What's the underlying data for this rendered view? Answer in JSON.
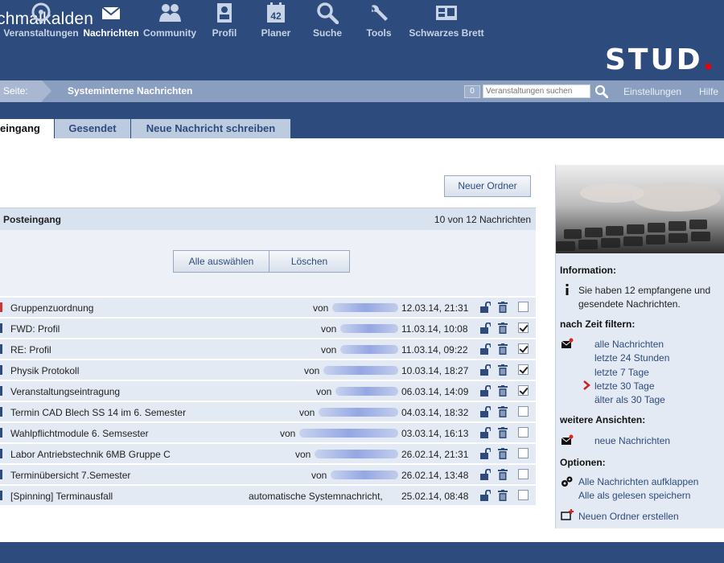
{
  "site_title": "chmalkalden",
  "nav": [
    {
      "label": "Veranstaltungen",
      "icon": "seminar-icon",
      "active": false
    },
    {
      "label": "Nachrichten",
      "icon": "mail-icon",
      "active": true
    },
    {
      "label": "Community",
      "icon": "community-icon",
      "active": false
    },
    {
      "label": "Profil",
      "icon": "profile-icon",
      "active": false
    },
    {
      "label": "Planer",
      "icon": "calendar-icon",
      "active": false,
      "badge": "42"
    },
    {
      "label": "Suche",
      "icon": "search-icon",
      "active": false
    },
    {
      "label": "Tools",
      "icon": "wrench-icon",
      "active": false
    },
    {
      "label": "Schwarzes Brett",
      "icon": "board-icon",
      "active": false
    }
  ],
  "logo": {
    "text": "STUD",
    "dot": "."
  },
  "breadcrumb": {
    "label": "Seite:",
    "page": "Systeminterne Nachrichten"
  },
  "search": {
    "count": "0",
    "placeholder": "Veranstaltungen suchen"
  },
  "top_links": {
    "settings": "Einstellungen",
    "help": "Hilfe"
  },
  "tabs": [
    {
      "label": "eingang",
      "active": true
    },
    {
      "label": "Gesendet",
      "active": false
    },
    {
      "label": "Neue Nachricht schreiben",
      "active": false
    }
  ],
  "buttons": {
    "new_folder": "Neuer Ordner",
    "select_all": "Alle auswählen",
    "delete": "Löschen"
  },
  "inbox": {
    "title": "Posteingang",
    "count": "10 von 12 Nachrichten"
  },
  "messages": [
    {
      "subject": "Gruppenzuordnung",
      "from_label": "von",
      "date": "12.03.14, 21:31",
      "checked": false,
      "marker": "red"
    },
    {
      "subject": "FWD: Profil",
      "from_label": "von",
      "date": "11.03.14, 10:08",
      "checked": true,
      "marker": "blue"
    },
    {
      "subject": "RE: Profil",
      "from_label": "von",
      "date": "11.03.14, 09:22",
      "checked": true,
      "marker": "blue"
    },
    {
      "subject": "Physik Protokoll",
      "from_label": "von",
      "date": "10.03.14, 18:27",
      "checked": true,
      "marker": "blue"
    },
    {
      "subject": "Veranstaltungseintragung",
      "from_label": "von",
      "date": "06.03.14, 14:09",
      "checked": true,
      "marker": "blue"
    },
    {
      "subject": "Termin CAD Blech SS 14 im 6. Semester",
      "from_label": "von",
      "date": "04.03.14, 18:32",
      "checked": false,
      "marker": "blue"
    },
    {
      "subject": "Wahlpflichtmodule 6. Semsester",
      "from_label": "von",
      "date": "03.03.14, 16:13",
      "checked": false,
      "marker": "blue"
    },
    {
      "subject": "Labor Antriebstechnik 6MB Gruppe C",
      "from_label": "von",
      "date": "26.02.14, 21:31",
      "checked": false,
      "marker": "blue"
    },
    {
      "subject": "Terminübersicht 7.Semester",
      "from_label": "von",
      "date": "26.02.14, 13:48",
      "checked": false,
      "marker": "blue"
    },
    {
      "subject": "[Spinning] Terminausfall",
      "from_label": "automatische Systemnachricht,",
      "date": "25.02.14, 08:48",
      "checked": false,
      "marker": "blue"
    }
  ],
  "sidebar": {
    "info_title": "Information:",
    "info_text_1": "Sie haben 12 empfangene und",
    "info_text_2": "gesendete Nachrichten.",
    "filter_title": "nach Zeit filtern:",
    "filters": [
      "alle Nachrichten",
      "letzte 24 Stunden",
      "letzte 7 Tage",
      "letzte 30 Tage",
      "älter als 30 Tage"
    ],
    "views_title": "weitere Ansichten:",
    "views_link": "neue Nachrichten",
    "options_title": "Optionen:",
    "option_expand": "Alle Nachrichten aufklappen",
    "option_mark_read": "Alle als gelesen speichern",
    "option_new_folder": "Neuen Ordner erstellen"
  },
  "colors": {
    "header_bg": "#2d4b7c",
    "row_bg": "#e4eaf3",
    "link": "#2d4b7c",
    "accent_red": "#c33"
  }
}
